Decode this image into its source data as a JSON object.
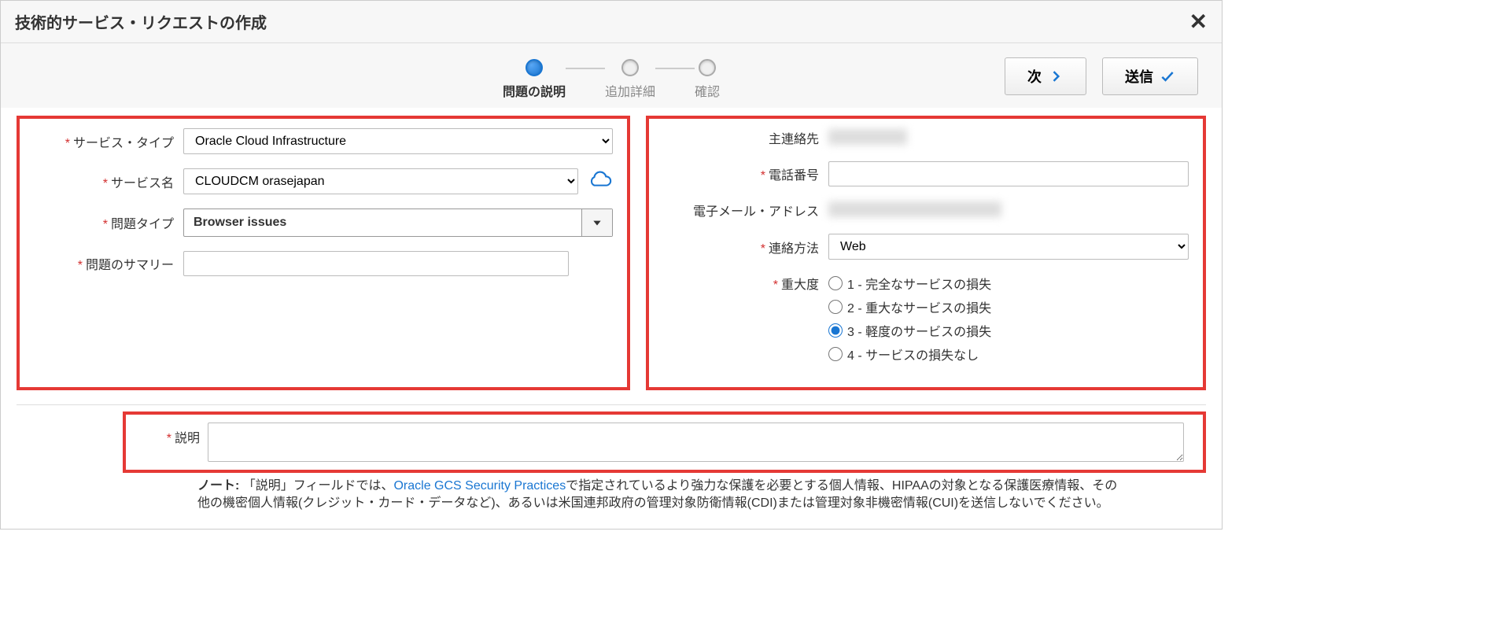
{
  "header": {
    "title": "技術的サービス・リクエストの作成"
  },
  "stepper": {
    "steps": [
      {
        "label": "問題の説明",
        "active": true
      },
      {
        "label": "追加詳細",
        "active": false
      },
      {
        "label": "確認",
        "active": false
      }
    ]
  },
  "actions": {
    "next_label": "次",
    "submit_label": "送信"
  },
  "left": {
    "service_type_label": "サービス・タイプ",
    "service_type_value": "Oracle Cloud Infrastructure",
    "service_name_label": "サービス名",
    "service_name_value": "CLOUDCM orasejapan",
    "problem_type_label": "問題タイプ",
    "problem_type_value": "Browser issues",
    "summary_label": "問題のサマリー",
    "summary_value": ""
  },
  "right": {
    "primary_contact_label": "主連絡先",
    "phone_label": "電話番号",
    "phone_value": "",
    "email_label": "電子メール・アドレス",
    "contact_method_label": "連絡方法",
    "contact_method_value": "Web",
    "severity_label": "重大度",
    "severity_options": [
      {
        "label": "1 - 完全なサービスの損失",
        "value": "1"
      },
      {
        "label": "2 - 重大なサービスの損失",
        "value": "2"
      },
      {
        "label": "3 - 軽度のサービスの損失",
        "value": "3"
      },
      {
        "label": "4 - サービスの損失なし",
        "value": "4"
      }
    ],
    "severity_selected": "3"
  },
  "description": {
    "label": "説明",
    "value": "",
    "note_prefix": "ノート: ",
    "note_text1": "「説明」フィールドでは、",
    "note_link_text": "Oracle GCS Security Practices",
    "note_text2": "で指定されているより強力な保護を必要とする個人情報、HIPAAの対象となる保護医療情報、その他の機密個人情報(クレジット・カード・データなど)、あるいは米国連邦政府の管理対象防衛情報(CDI)または管理対象非機密情報(CUI)を送信しないでください。"
  }
}
